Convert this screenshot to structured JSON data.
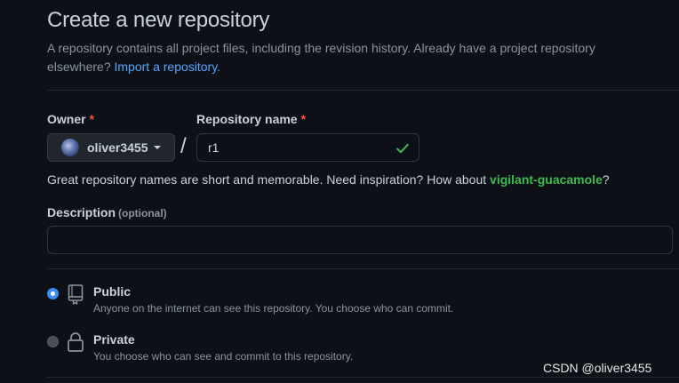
{
  "header": {
    "title": "Create a new repository",
    "subtitle": "A repository contains all project files, including the revision history. Already have a project repository elsewhere?",
    "import_link": "Import a repository."
  },
  "owner": {
    "label": "Owner",
    "required_mark": "*",
    "selected": "oliver3455"
  },
  "separator": "/",
  "repo_name": {
    "label": "Repository name",
    "required_mark": "*",
    "value": "r1",
    "valid": true
  },
  "name_hint": {
    "text": "Great repository names are short and memorable. Need inspiration? How about",
    "suggestion": "vigilant-guacamole",
    "suffix": "?"
  },
  "description": {
    "label": "Description",
    "optional": "(optional)",
    "value": ""
  },
  "visibility": {
    "selected": "public",
    "public": {
      "title": "Public",
      "desc": "Anyone on the internet can see this repository. You choose who can commit."
    },
    "private": {
      "title": "Private",
      "desc": "You choose who can see and commit to this repository."
    }
  },
  "watermark": "CSDN @oliver3455",
  "colors": {
    "background": "#0d1117",
    "link": "#58a6ff",
    "success": "#3fb950",
    "required": "#f85149",
    "radio_checked": "#3b8cf4"
  },
  "icons": {
    "check": "check-icon",
    "public": "repo-icon",
    "private": "lock-icon"
  }
}
